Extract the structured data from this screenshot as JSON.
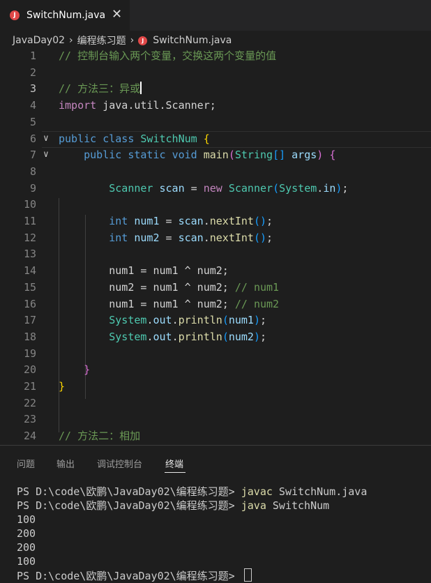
{
  "tab": {
    "icon": "java-file-icon",
    "label": "SwitchNum.java",
    "close": "✕"
  },
  "breadcrumb": {
    "parts": [
      "JavaDay02",
      "编程练习题",
      "SwitchNum.java"
    ],
    "sep": "›"
  },
  "editor": {
    "lines": [
      {
        "n": "1",
        "fold": "",
        "parts": [
          {
            "c": "cm",
            "t": "// 控制台输入两个变量，交换这两个变量的值"
          }
        ]
      },
      {
        "n": "2",
        "fold": "",
        "parts": []
      },
      {
        "n": "3",
        "fold": "",
        "cursor": true,
        "parts": [
          {
            "c": "cm",
            "t": "// 方法三：异或"
          }
        ]
      },
      {
        "n": "4",
        "fold": "",
        "parts": [
          {
            "c": "kwc",
            "t": "import"
          },
          {
            "c": "pl",
            "t": " java.util.Scanner;"
          }
        ]
      },
      {
        "n": "5",
        "fold": "",
        "parts": []
      },
      {
        "n": "6",
        "fold": "∨",
        "parts": [
          {
            "c": "kw",
            "t": "public"
          },
          {
            "c": "pl",
            "t": " "
          },
          {
            "c": "kw",
            "t": "class"
          },
          {
            "c": "pl",
            "t": " "
          },
          {
            "c": "ty",
            "t": "SwitchNum"
          },
          {
            "c": "pl",
            "t": " "
          },
          {
            "c": "b1",
            "t": "{"
          }
        ]
      },
      {
        "n": "7",
        "fold": "∨",
        "parts": [
          {
            "c": "pl",
            "t": "    "
          },
          {
            "c": "kw",
            "t": "public"
          },
          {
            "c": "pl",
            "t": " "
          },
          {
            "c": "kw",
            "t": "static"
          },
          {
            "c": "pl",
            "t": " "
          },
          {
            "c": "kw",
            "t": "void"
          },
          {
            "c": "pl",
            "t": " "
          },
          {
            "c": "fn",
            "t": "main"
          },
          {
            "c": "b2",
            "t": "("
          },
          {
            "c": "ty",
            "t": "String"
          },
          {
            "c": "b3",
            "t": "[]"
          },
          {
            "c": "pl",
            "t": " "
          },
          {
            "c": "vr",
            "t": "args"
          },
          {
            "c": "b2",
            "t": ")"
          },
          {
            "c": "pl",
            "t": " "
          },
          {
            "c": "b2",
            "t": "{"
          }
        ]
      },
      {
        "n": "8",
        "fold": "",
        "parts": []
      },
      {
        "n": "9",
        "fold": "",
        "parts": [
          {
            "c": "pl",
            "t": "        "
          },
          {
            "c": "ty",
            "t": "Scanner"
          },
          {
            "c": "pl",
            "t": " "
          },
          {
            "c": "vr",
            "t": "scan"
          },
          {
            "c": "pl",
            "t": " = "
          },
          {
            "c": "kwc",
            "t": "new"
          },
          {
            "c": "pl",
            "t": " "
          },
          {
            "c": "ty",
            "t": "Scanner"
          },
          {
            "c": "b3",
            "t": "("
          },
          {
            "c": "ty",
            "t": "System"
          },
          {
            "c": "pl",
            "t": "."
          },
          {
            "c": "vr",
            "t": "in"
          },
          {
            "c": "b3",
            "t": ")"
          },
          {
            "c": "pl",
            "t": ";"
          }
        ]
      },
      {
        "n": "10",
        "fold": "",
        "parts": []
      },
      {
        "n": "11",
        "fold": "",
        "parts": [
          {
            "c": "pl",
            "t": "        "
          },
          {
            "c": "kw",
            "t": "int"
          },
          {
            "c": "pl",
            "t": " "
          },
          {
            "c": "vr",
            "t": "num1"
          },
          {
            "c": "pl",
            "t": " = "
          },
          {
            "c": "vr",
            "t": "scan"
          },
          {
            "c": "pl",
            "t": "."
          },
          {
            "c": "fn",
            "t": "nextInt"
          },
          {
            "c": "b3",
            "t": "()"
          },
          {
            "c": "pl",
            "t": ";"
          }
        ]
      },
      {
        "n": "12",
        "fold": "",
        "parts": [
          {
            "c": "pl",
            "t": "        "
          },
          {
            "c": "kw",
            "t": "int"
          },
          {
            "c": "pl",
            "t": " "
          },
          {
            "c": "vr",
            "t": "num2"
          },
          {
            "c": "pl",
            "t": " = "
          },
          {
            "c": "vr",
            "t": "scan"
          },
          {
            "c": "pl",
            "t": "."
          },
          {
            "c": "fn",
            "t": "nextInt"
          },
          {
            "c": "b3",
            "t": "()"
          },
          {
            "c": "pl",
            "t": ";"
          }
        ]
      },
      {
        "n": "13",
        "fold": "",
        "parts": []
      },
      {
        "n": "14",
        "fold": "",
        "parts": [
          {
            "c": "pl",
            "t": "        num1 = num1 ^ num2;"
          }
        ]
      },
      {
        "n": "15",
        "fold": "",
        "parts": [
          {
            "c": "pl",
            "t": "        num2 = num1 ^ num2; "
          },
          {
            "c": "cm",
            "t": "// num1"
          }
        ]
      },
      {
        "n": "16",
        "fold": "",
        "parts": [
          {
            "c": "pl",
            "t": "        num1 = num1 ^ num2; "
          },
          {
            "c": "cm",
            "t": "// num2"
          }
        ]
      },
      {
        "n": "17",
        "fold": "",
        "parts": [
          {
            "c": "pl",
            "t": "        "
          },
          {
            "c": "ty",
            "t": "System"
          },
          {
            "c": "pl",
            "t": "."
          },
          {
            "c": "vr",
            "t": "out"
          },
          {
            "c": "pl",
            "t": "."
          },
          {
            "c": "fn",
            "t": "println"
          },
          {
            "c": "b3",
            "t": "("
          },
          {
            "c": "vr",
            "t": "num1"
          },
          {
            "c": "b3",
            "t": ")"
          },
          {
            "c": "pl",
            "t": ";"
          }
        ]
      },
      {
        "n": "18",
        "fold": "",
        "parts": [
          {
            "c": "pl",
            "t": "        "
          },
          {
            "c": "ty",
            "t": "System"
          },
          {
            "c": "pl",
            "t": "."
          },
          {
            "c": "vr",
            "t": "out"
          },
          {
            "c": "pl",
            "t": "."
          },
          {
            "c": "fn",
            "t": "println"
          },
          {
            "c": "b3",
            "t": "("
          },
          {
            "c": "vr",
            "t": "num2"
          },
          {
            "c": "b3",
            "t": ")"
          },
          {
            "c": "pl",
            "t": ";"
          }
        ]
      },
      {
        "n": "19",
        "fold": "",
        "parts": []
      },
      {
        "n": "20",
        "fold": "",
        "parts": [
          {
            "c": "pl",
            "t": "    "
          },
          {
            "c": "b2",
            "t": "}"
          }
        ]
      },
      {
        "n": "21",
        "fold": "",
        "parts": [
          {
            "c": "b1",
            "t": "}"
          }
        ]
      },
      {
        "n": "22",
        "fold": "",
        "parts": []
      },
      {
        "n": "23",
        "fold": "",
        "parts": []
      },
      {
        "n": "24",
        "fold": "",
        "parts": [
          {
            "c": "cm",
            "t": "// 方法二：相加"
          }
        ]
      }
    ]
  },
  "panel": {
    "tabs": [
      "问题",
      "输出",
      "调试控制台",
      "终端"
    ],
    "active_tab": "终端",
    "terminal": {
      "lines": [
        {
          "prompt": "PS D:\\code\\欧鹏\\JavaDay02\\编程练习题> ",
          "cmd": "javac",
          "arg": " SwitchNum.java"
        },
        {
          "prompt": "PS D:\\code\\欧鹏\\JavaDay02\\编程练习题> ",
          "cmd": "java",
          "arg": " SwitchNum"
        },
        {
          "prompt": "100",
          "cmd": "",
          "arg": ""
        },
        {
          "prompt": "200",
          "cmd": "",
          "arg": ""
        },
        {
          "prompt": "200",
          "cmd": "",
          "arg": ""
        },
        {
          "prompt": "100",
          "cmd": "",
          "arg": ""
        },
        {
          "prompt": "PS D:\\code\\欧鹏\\JavaDay02\\编程练习题> ",
          "cmd": "",
          "arg": "",
          "cursor": true
        }
      ]
    }
  },
  "colors": {
    "background": "#1e1e1e",
    "tabbar": "#252526",
    "comment": "#6a9955",
    "keyword": "#569cd6",
    "type": "#4ec9b0"
  }
}
